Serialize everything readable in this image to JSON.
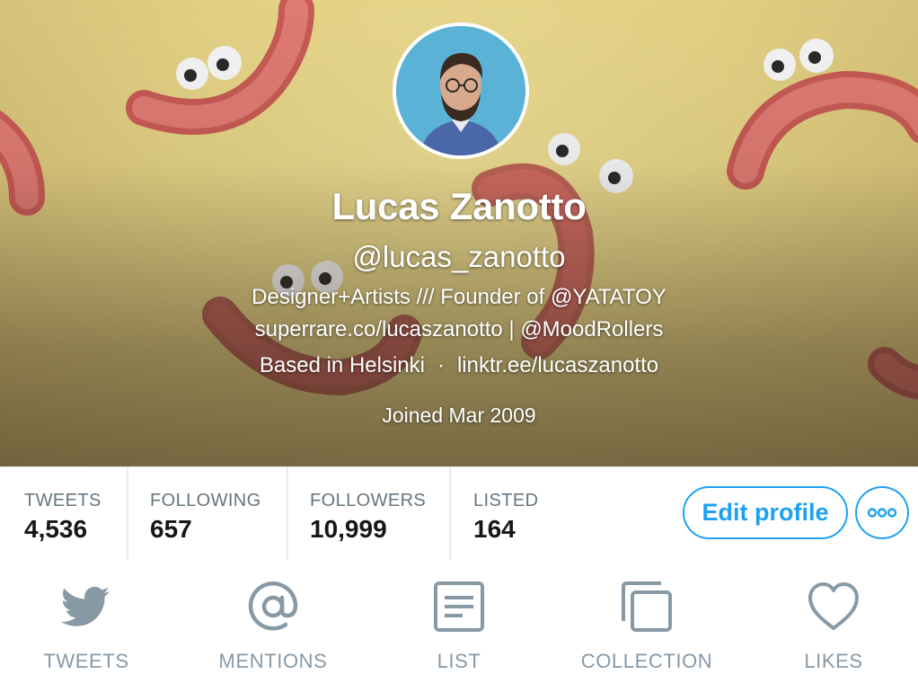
{
  "profile": {
    "name": "Lucas Zanotto",
    "handle": "@lucas_zanotto",
    "bio_line_1": "Designer+Artists /// Founder of @YATATOY",
    "bio_line_2": "superrare.co/lucaszanotto | @MoodRollers",
    "location": "Based in Helsinki",
    "separator": "·",
    "website": "linktr.ee/lucaszanotto",
    "joined": "Joined Mar 2009"
  },
  "stats": [
    {
      "label": "TWEETS",
      "value": "4,536"
    },
    {
      "label": "FOLLOWING",
      "value": "657"
    },
    {
      "label": "FOLLOWERS",
      "value": "10,999"
    },
    {
      "label": "LISTED",
      "value": "164"
    }
  ],
  "actions": {
    "edit_profile": "Edit profile",
    "more_icon": "more-horizontal-icon"
  },
  "tabs": [
    {
      "label": "TWEETS",
      "icon": "bird-icon"
    },
    {
      "label": "MENTIONS",
      "icon": "at-sign-icon"
    },
    {
      "label": "LIST",
      "icon": "list-icon"
    },
    {
      "label": "COLLECTION",
      "icon": "collection-icon"
    },
    {
      "label": "LIKES",
      "icon": "heart-icon"
    }
  ],
  "colors": {
    "accent": "#1da1f2",
    "tab_icon": "#8899a6",
    "stat_label": "#66757f",
    "stat_value": "#14171a",
    "banner_bg": "#e2d083",
    "banner_shape": "#d86a63"
  }
}
